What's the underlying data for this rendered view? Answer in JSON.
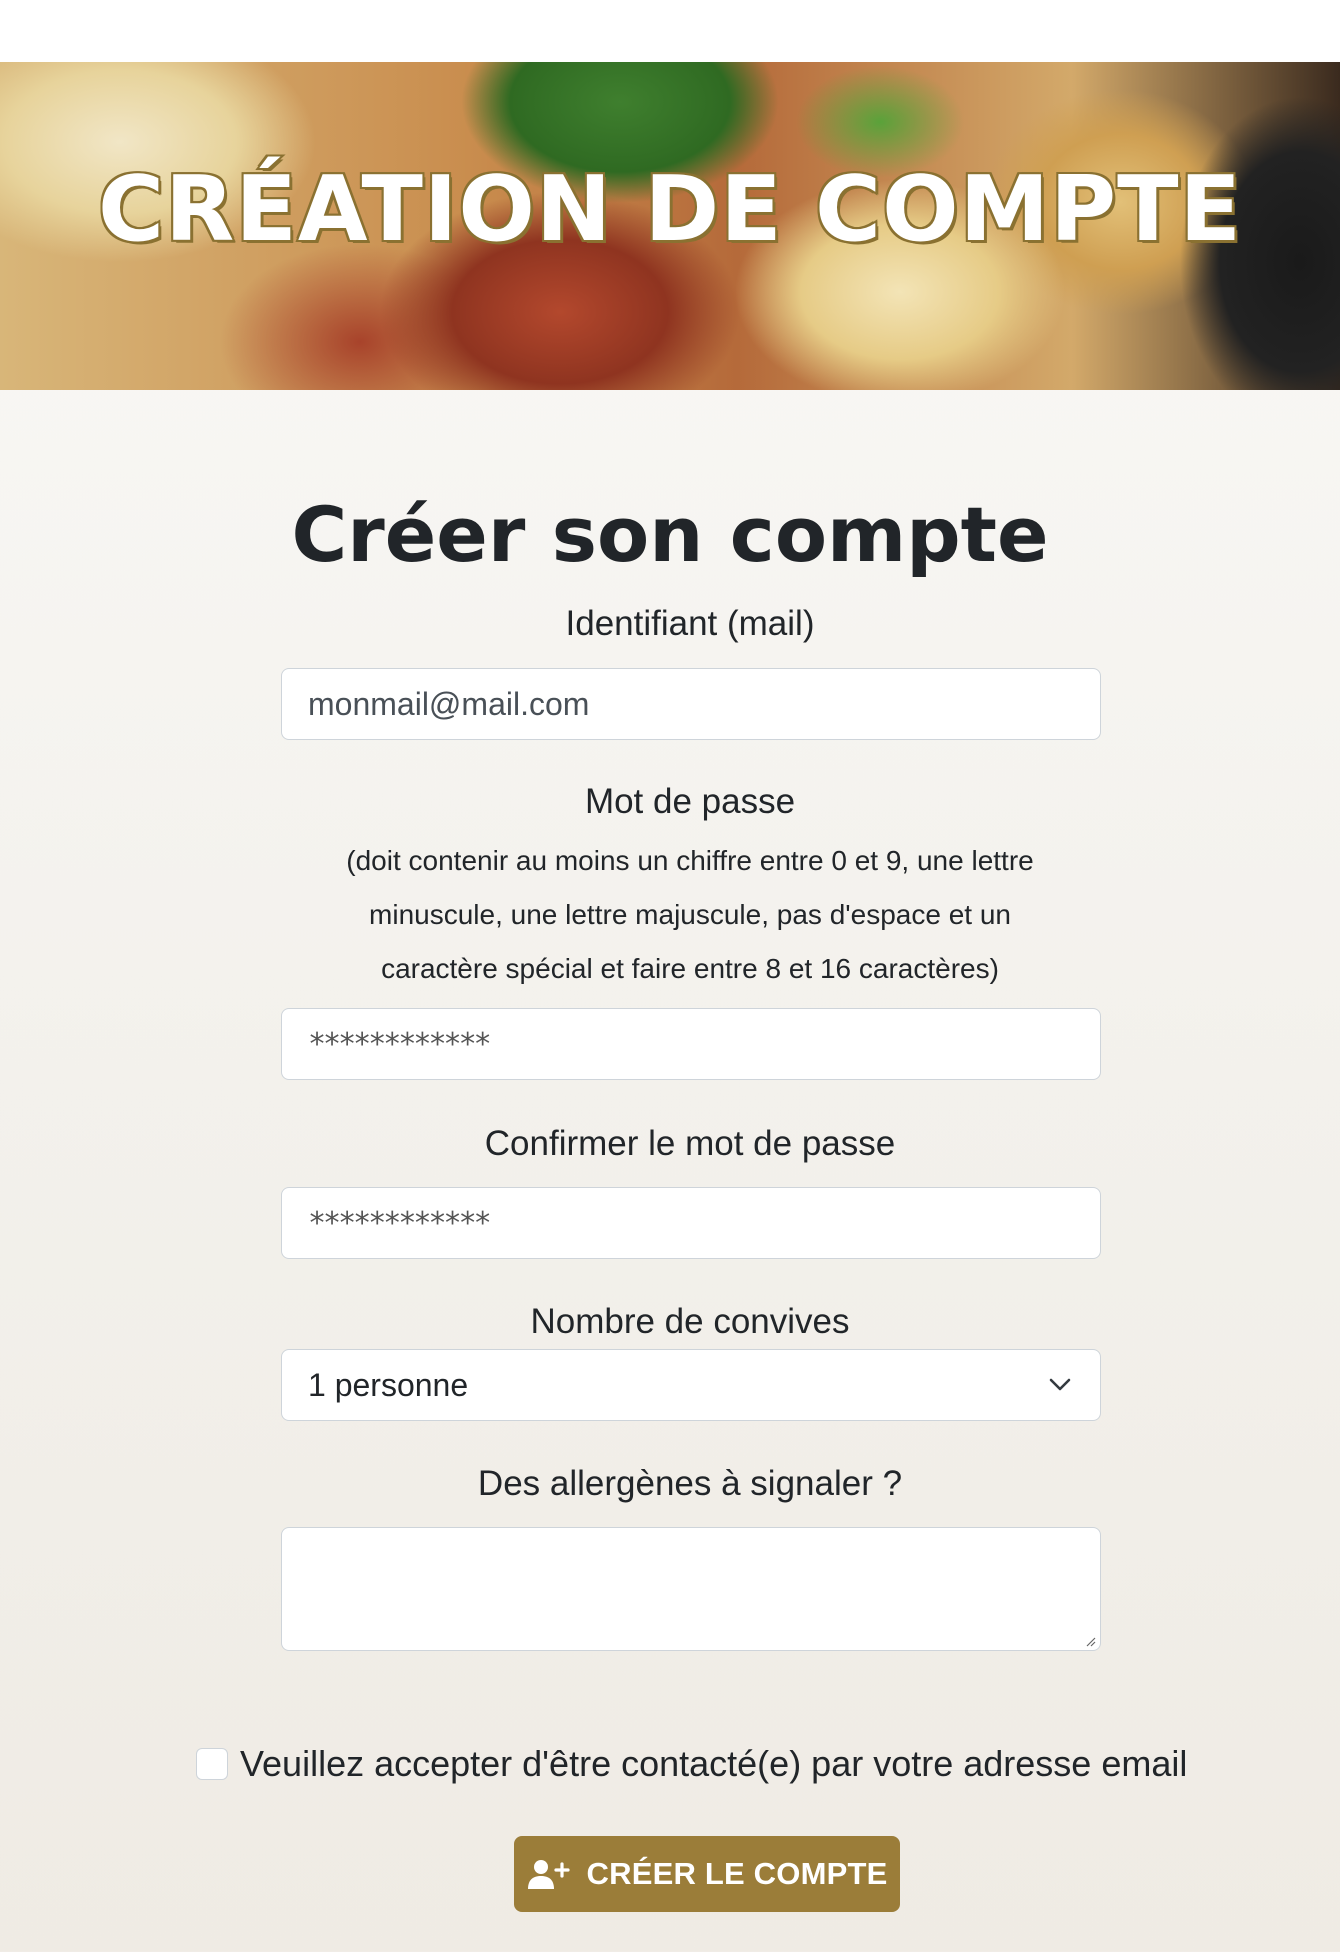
{
  "hero": {
    "title": "CRÉATION DE COMPTE"
  },
  "form": {
    "title": "Créer son compte",
    "email": {
      "label": "Identifiant (mail)",
      "placeholder": "monmail@mail.com"
    },
    "password": {
      "label": "Mot de passe",
      "help_lines": [
        "(doit contenir au moins un chiffre entre 0 et 9, une lettre",
        "minuscule, une lettre majuscule, pas d'espace et un",
        "caractère spécial et faire entre 8 et 16 caractères)"
      ],
      "placeholder": "************"
    },
    "confirm": {
      "label": "Confirmer le mot de passe",
      "placeholder": "************"
    },
    "guests": {
      "label": "Nombre de convives",
      "selected": "1 personne",
      "icon": "chevron-down-icon"
    },
    "allergens": {
      "label": "Des allergènes à signaler ?"
    },
    "consent": {
      "label": "Veuillez accepter d'être contacté(e) par votre adresse email",
      "checked": false
    },
    "submit": {
      "label": "CRÉER LE COMPTE",
      "icon": "user-plus-icon",
      "color": "#9b7d39"
    }
  }
}
